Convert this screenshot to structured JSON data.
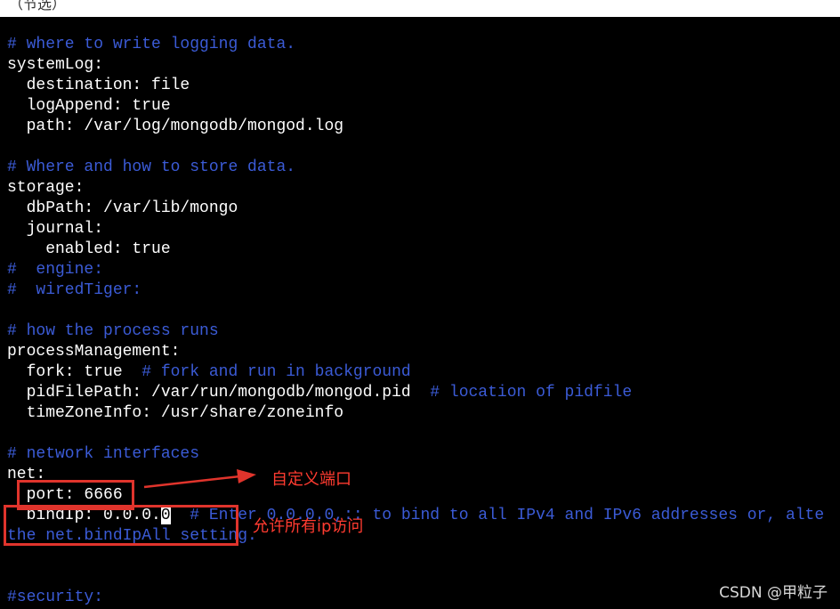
{
  "header": {
    "title": "（节选）"
  },
  "config_lines": [
    {
      "text": "# where to write logging data.",
      "kind": "comment"
    },
    {
      "text": "systemLog:",
      "kind": "code"
    },
    {
      "text": "  destination: file",
      "kind": "code"
    },
    {
      "text": "  logAppend: true",
      "kind": "code"
    },
    {
      "text": "  path: /var/log/mongodb/mongod.log",
      "kind": "code"
    },
    {
      "text": "",
      "kind": "blank"
    },
    {
      "text": "# Where and how to store data.",
      "kind": "comment"
    },
    {
      "text": "storage:",
      "kind": "code"
    },
    {
      "text": "  dbPath: /var/lib/mongo",
      "kind": "code"
    },
    {
      "text": "  journal:",
      "kind": "code"
    },
    {
      "text": "    enabled: true",
      "kind": "code"
    },
    {
      "text": "#  engine:",
      "kind": "comment"
    },
    {
      "text": "#  wiredTiger:",
      "kind": "comment"
    },
    {
      "text": "",
      "kind": "blank"
    },
    {
      "text": "# how the process runs",
      "kind": "comment"
    },
    {
      "text": "processManagement:",
      "kind": "code"
    },
    {
      "text": "  fork: true",
      "kind": "code",
      "comment": "  # fork and run in background"
    },
    {
      "text": "  pidFilePath: /var/run/mongodb/mongod.pid",
      "kind": "code",
      "comment": "  # location of pidfile"
    },
    {
      "text": "  timeZoneInfo: /usr/share/zoneinfo",
      "kind": "code"
    },
    {
      "text": "",
      "kind": "blank"
    },
    {
      "text": "# network interfaces",
      "kind": "comment"
    },
    {
      "text": "net:",
      "kind": "code"
    },
    {
      "text": "  port: 6666",
      "kind": "code"
    },
    {
      "text": "  bindIp: 0.0.0.",
      "kind": "code",
      "cursor": "0",
      "comment": "  # Enter 0.0.0.0,:: to bind to all IPv4 and IPv6 addresses or, alte"
    },
    {
      "text": "the net.bindIpAll setting.",
      "kind": "comment"
    },
    {
      "text": "",
      "kind": "blank"
    },
    {
      "text": "",
      "kind": "blank"
    },
    {
      "text": "#security:",
      "kind": "comment"
    }
  ],
  "annotations": {
    "port_label": "自定义端口",
    "bindip_label": "允许所有ip访问"
  },
  "watermark": "CSDN @甲粒子",
  "colors": {
    "background": "#000000",
    "text": "#ffffff",
    "comment": "#3b5bd6",
    "annotation": "#e0342c"
  }
}
